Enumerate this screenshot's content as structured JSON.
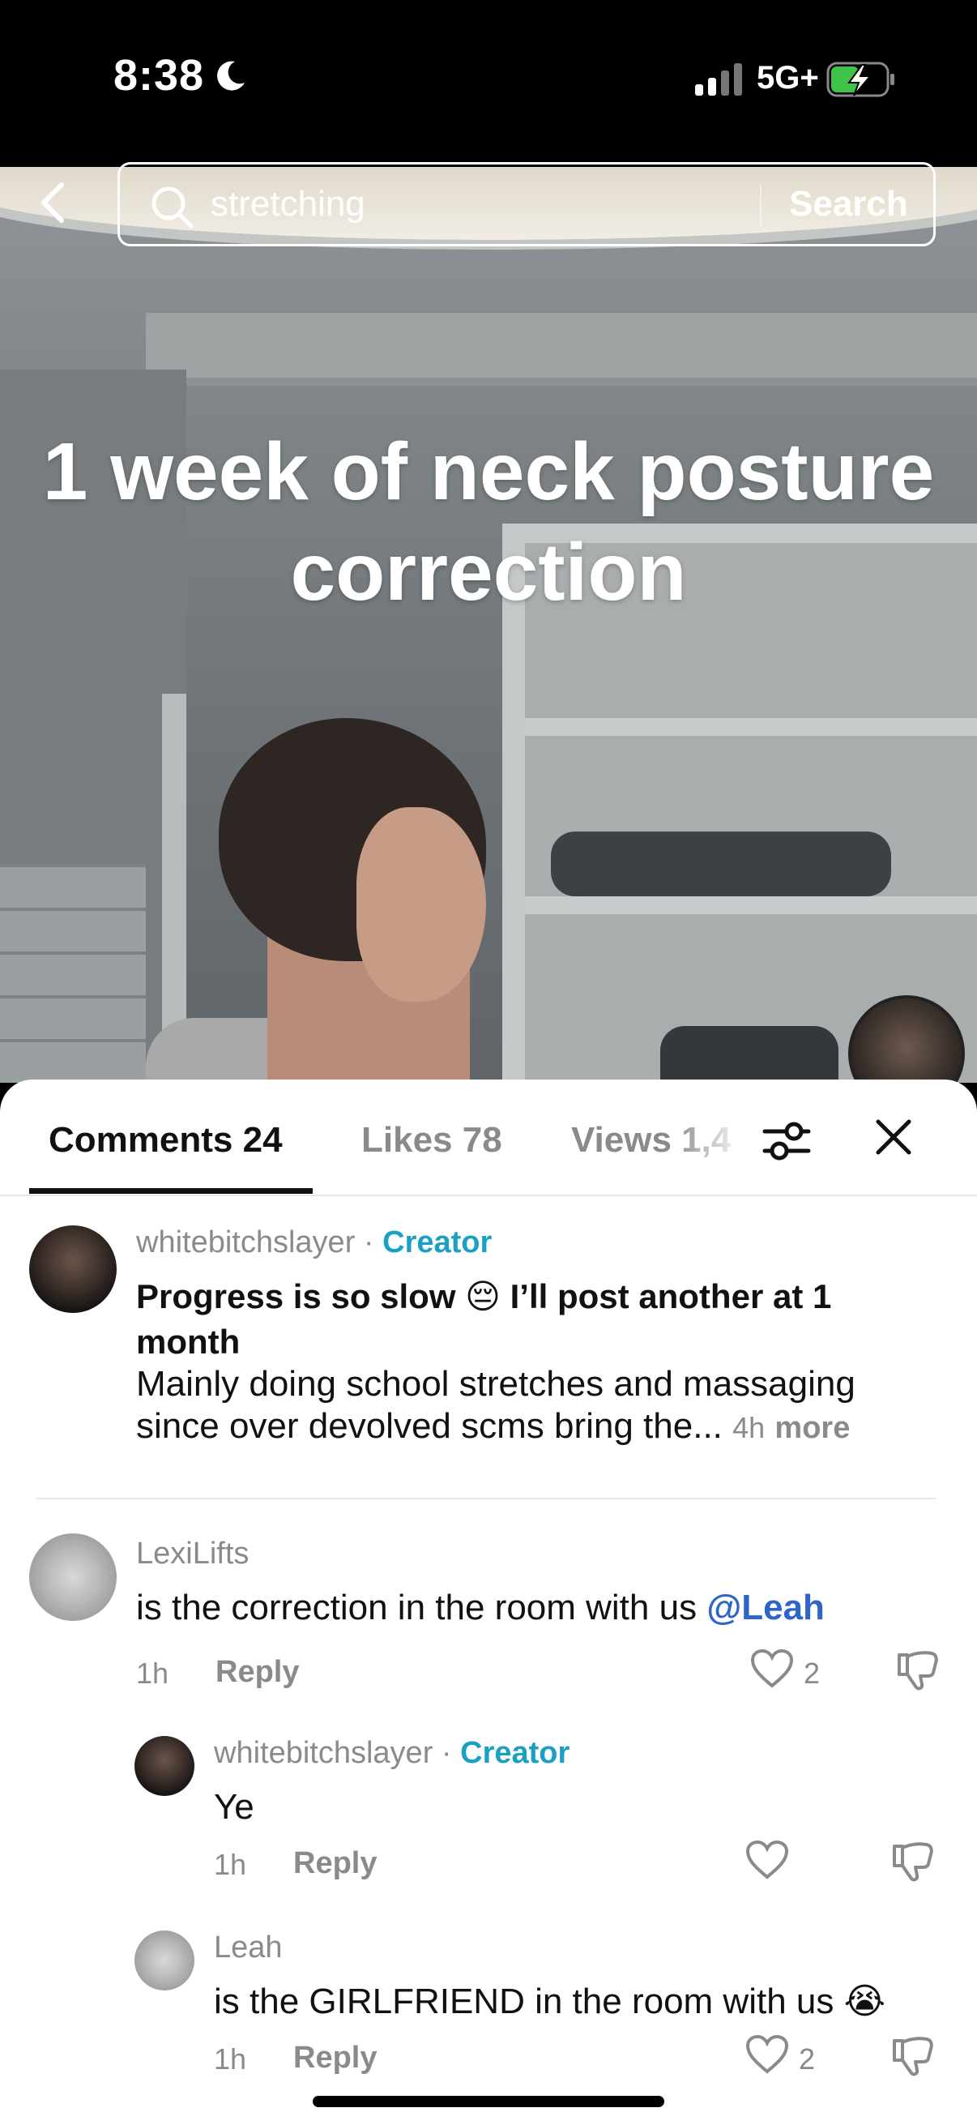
{
  "status_bar": {
    "time": "8:38",
    "network": "5G+",
    "do_not_disturb_icon": "moon-icon",
    "signal_icon": "signal-icon",
    "battery_icon": "battery-charging-icon"
  },
  "search": {
    "query": "stretching",
    "button_label": "Search"
  },
  "video": {
    "caption_line1": "1 week of neck posture",
    "caption_line2": "correction"
  },
  "tabs": [
    {
      "label": "Comments 24",
      "active": true
    },
    {
      "label": "Likes 78",
      "active": false
    },
    {
      "label": "Views 1,4",
      "active": false
    }
  ],
  "comments": [
    {
      "username": "whitebitchslayer",
      "badge": "Creator",
      "text_line1": "Progress is so slow 😔 I’ll post another at 1",
      "text_line2": "month",
      "text_line3": "Mainly doing school stretches and massaging",
      "text_line4": "since over devolved scms bring the...",
      "time": "4h",
      "more": "more"
    },
    {
      "username": "LexiLifts",
      "text": "is the correction in the room with us ",
      "mention": "@Leah",
      "time": "1h",
      "reply_label": "Reply",
      "likes": "2"
    },
    {
      "username": "whitebitchslayer",
      "badge": "Creator",
      "text": "Ye",
      "time": "1h",
      "reply_label": "Reply"
    },
    {
      "username": "Leah",
      "text": "is the GIRLFRIEND in the room with us 😭",
      "time": "1h",
      "reply_label": "Reply",
      "likes": "2"
    }
  ],
  "colors": {
    "creator_badge": "#1aa0c4",
    "mention": "#2f64c9",
    "text": "#111111",
    "muted": "#8a8a8a"
  }
}
